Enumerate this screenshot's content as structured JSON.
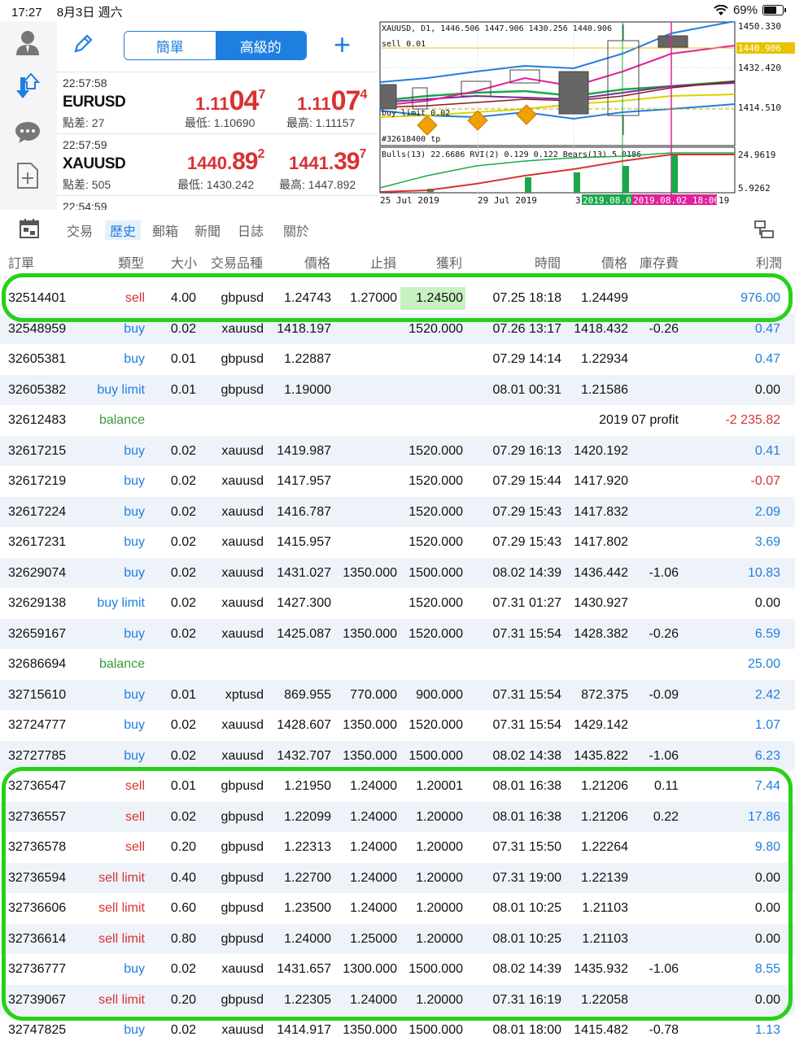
{
  "status": {
    "time": "17:27",
    "date": "8月3日 週六",
    "battery": "69%",
    "battery_level": 0.69
  },
  "toolbar": {
    "seg_simple": "簡單",
    "seg_advanced": "高級的",
    "plus": "+"
  },
  "quotes": [
    {
      "time": "22:57:58",
      "symbol": "EURUSD",
      "spread": "點差: 27",
      "bid_a": "1.11",
      "bid_b": "04",
      "bid_c": "7",
      "ask_a": "1.11",
      "ask_b": "07",
      "ask_c": "4",
      "low": "最低: 1.10690",
      "high": "最高: 1.11157"
    },
    {
      "time": "22:57:59",
      "symbol": "XAUUSD",
      "spread": "點差: 505",
      "bid_a": "1440.",
      "bid_b": "89",
      "bid_c": "2",
      "ask_a": "1441.",
      "ask_b": "39",
      "ask_c": "7",
      "low": "最低: 1430.242",
      "high": "最高: 1447.892"
    },
    {
      "time": "22:54:59"
    }
  ],
  "chart": {
    "header": "XAUUSD, D1, 1446.506 1447.906 1430.256 1440.906",
    "sell_label": "sell 0.01",
    "buy_limit_label": "buy limit 0.02",
    "tp_label": "#32618400 tp",
    "price_axis": [
      "1450.330",
      "1440.906",
      "1432.420",
      "1414.510"
    ],
    "indicator_header": "Bulls(13) 22.6686 RVI(2) 0.129 0.122 Bears(13) 5.0186",
    "ind_axis": [
      "24.9619",
      "5.9262"
    ],
    "dates": [
      "25 Jul 2019",
      "29 Jul 2019",
      "3"
    ],
    "date_tag1": "2019.08.0",
    "date_tag2": "2019.08.02 18:00",
    "date_tail": "19",
    "colors": {
      "bid_line": "#e8c200",
      "price_tag": "#e8c200",
      "green_tag": "#1aa84a",
      "pink_tag": "#e0209a"
    }
  },
  "tabs": {
    "trade": "交易",
    "history": "歷史",
    "mail": "郵箱",
    "news": "新聞",
    "journal": "日誌",
    "about": "關於"
  },
  "columns": {
    "order": "訂單",
    "type": "類型",
    "size": "大小",
    "symbol": "交易品種",
    "price": "價格",
    "sl": "止損",
    "tp": "獲利",
    "time": "時間",
    "close_price": "價格",
    "swap": "庫存費",
    "profit": "利潤"
  },
  "rows": [
    {
      "order": "32514401",
      "type": "sell",
      "size": "4.00",
      "symbol": "gbpusd",
      "price": "1.24743",
      "sl": "1.27000",
      "tp": "1.24500",
      "time": "07.25 18:18",
      "close_price": "1.24499",
      "swap": "",
      "profit": "976.00"
    },
    {
      "order": "32548959",
      "type": "buy",
      "size": "0.02",
      "symbol": "xauusd",
      "price": "1418.197",
      "sl": "",
      "tp": "1520.000",
      "time": "07.26 13:17",
      "close_price": "1418.432",
      "swap": "-0.26",
      "profit": "0.47"
    },
    {
      "order": "32605381",
      "type": "buy",
      "size": "0.01",
      "symbol": "gbpusd",
      "price": "1.22887",
      "sl": "",
      "tp": "",
      "time": "07.29 14:14",
      "close_price": "1.22934",
      "swap": "",
      "profit": "0.47"
    },
    {
      "order": "32605382",
      "type": "buy limit",
      "size": "0.01",
      "symbol": "gbpusd",
      "price": "1.19000",
      "sl": "",
      "tp": "",
      "time": "08.01 00:31",
      "close_price": "1.21586",
      "swap": "",
      "profit": "0.00"
    },
    {
      "order": "32612483",
      "type": "balance",
      "size": "",
      "symbol": "",
      "price": "",
      "sl": "",
      "tp": "",
      "time": "",
      "close_price": "",
      "swap": "",
      "comment": "2019 07 profit",
      "profit": "-2 235.82"
    },
    {
      "order": "32617215",
      "type": "buy",
      "size": "0.02",
      "symbol": "xauusd",
      "price": "1419.987",
      "sl": "",
      "tp": "1520.000",
      "time": "07.29 16:13",
      "close_price": "1420.192",
      "swap": "",
      "profit": "0.41"
    },
    {
      "order": "32617219",
      "type": "buy",
      "size": "0.02",
      "symbol": "xauusd",
      "price": "1417.957",
      "sl": "",
      "tp": "1520.000",
      "time": "07.29 15:44",
      "close_price": "1417.920",
      "swap": "",
      "profit": "-0.07"
    },
    {
      "order": "32617224",
      "type": "buy",
      "size": "0.02",
      "symbol": "xauusd",
      "price": "1416.787",
      "sl": "",
      "tp": "1520.000",
      "time": "07.29 15:43",
      "close_price": "1417.832",
      "swap": "",
      "profit": "2.09"
    },
    {
      "order": "32617231",
      "type": "buy",
      "size": "0.02",
      "symbol": "xauusd",
      "price": "1415.957",
      "sl": "",
      "tp": "1520.000",
      "time": "07.29 15:43",
      "close_price": "1417.802",
      "swap": "",
      "profit": "3.69"
    },
    {
      "order": "32629074",
      "type": "buy",
      "size": "0.02",
      "symbol": "xauusd",
      "price": "1431.027",
      "sl": "1350.000",
      "tp": "1500.000",
      "time": "08.02 14:39",
      "close_price": "1436.442",
      "swap": "-1.06",
      "profit": "10.83"
    },
    {
      "order": "32629138",
      "type": "buy limit",
      "size": "0.02",
      "symbol": "xauusd",
      "price": "1427.300",
      "sl": "",
      "tp": "1520.000",
      "time": "07.31 01:27",
      "close_price": "1430.927",
      "swap": "",
      "profit": "0.00"
    },
    {
      "order": "32659167",
      "type": "buy",
      "size": "0.02",
      "symbol": "xauusd",
      "price": "1425.087",
      "sl": "1350.000",
      "tp": "1520.000",
      "time": "07.31 15:54",
      "close_price": "1428.382",
      "swap": "-0.26",
      "profit": "6.59"
    },
    {
      "order": "32686694",
      "type": "balance",
      "size": "",
      "symbol": "",
      "price": "",
      "sl": "",
      "tp": "",
      "time": "",
      "close_price": "",
      "swap": "",
      "profit": "25.00"
    },
    {
      "order": "32715610",
      "type": "buy",
      "size": "0.01",
      "symbol": "xptusd",
      "price": "869.955",
      "sl": "770.000",
      "tp": "900.000",
      "time": "07.31 15:54",
      "close_price": "872.375",
      "swap": "-0.09",
      "profit": "2.42"
    },
    {
      "order": "32724777",
      "type": "buy",
      "size": "0.02",
      "symbol": "xauusd",
      "price": "1428.607",
      "sl": "1350.000",
      "tp": "1520.000",
      "time": "07.31 15:54",
      "close_price": "1429.142",
      "swap": "",
      "profit": "1.07"
    },
    {
      "order": "32727785",
      "type": "buy",
      "size": "0.02",
      "symbol": "xauusd",
      "price": "1432.707",
      "sl": "1350.000",
      "tp": "1500.000",
      "time": "08.02 14:38",
      "close_price": "1435.822",
      "swap": "-1.06",
      "profit": "6.23"
    },
    {
      "order": "32736547",
      "type": "sell",
      "size": "0.01",
      "symbol": "gbpusd",
      "price": "1.21950",
      "sl": "1.24000",
      "tp": "1.20001",
      "time": "08.01 16:38",
      "close_price": "1.21206",
      "swap": "0.11",
      "profit": "7.44"
    },
    {
      "order": "32736557",
      "type": "sell",
      "size": "0.02",
      "symbol": "gbpusd",
      "price": "1.22099",
      "sl": "1.24000",
      "tp": "1.20000",
      "time": "08.01 16:38",
      "close_price": "1.21206",
      "swap": "0.22",
      "profit": "17.86"
    },
    {
      "order": "32736578",
      "type": "sell",
      "size": "0.20",
      "symbol": "gbpusd",
      "price": "1.22313",
      "sl": "1.24000",
      "tp": "1.20000",
      "time": "07.31 15:50",
      "close_price": "1.22264",
      "swap": "",
      "profit": "9.80"
    },
    {
      "order": "32736594",
      "type": "sell limit",
      "size": "0.40",
      "symbol": "gbpusd",
      "price": "1.22700",
      "sl": "1.24000",
      "tp": "1.20000",
      "time": "07.31 19:00",
      "close_price": "1.22139",
      "swap": "",
      "profit": "0.00"
    },
    {
      "order": "32736606",
      "type": "sell limit",
      "size": "0.60",
      "symbol": "gbpusd",
      "price": "1.23500",
      "sl": "1.24000",
      "tp": "1.20000",
      "time": "08.01 10:25",
      "close_price": "1.21103",
      "swap": "",
      "profit": "0.00"
    },
    {
      "order": "32736614",
      "type": "sell limit",
      "size": "0.80",
      "symbol": "gbpusd",
      "price": "1.24000",
      "sl": "1.25000",
      "tp": "1.20000",
      "time": "08.01 10:25",
      "close_price": "1.21103",
      "swap": "",
      "profit": "0.00"
    },
    {
      "order": "32736777",
      "type": "buy",
      "size": "0.02",
      "symbol": "xauusd",
      "price": "1431.657",
      "sl": "1300.000",
      "tp": "1500.000",
      "time": "08.02 14:39",
      "close_price": "1435.932",
      "swap": "-1.06",
      "profit": "8.55"
    },
    {
      "order": "32739067",
      "type": "sell limit",
      "size": "0.20",
      "symbol": "gbpusd",
      "price": "1.22305",
      "sl": "1.24000",
      "tp": "1.20000",
      "time": "07.31 16:19",
      "close_price": "1.22058",
      "swap": "",
      "profit": "0.00"
    },
    {
      "order": "32747825",
      "type": "buy",
      "size": "0.02",
      "symbol": "xauusd",
      "price": "1414.917",
      "sl": "1350.000",
      "tp": "1500.000",
      "time": "08.01 18:00",
      "close_price": "1415.482",
      "swap": "-0.78",
      "profit": "1.13"
    }
  ],
  "highlight_color": "#27d11a"
}
